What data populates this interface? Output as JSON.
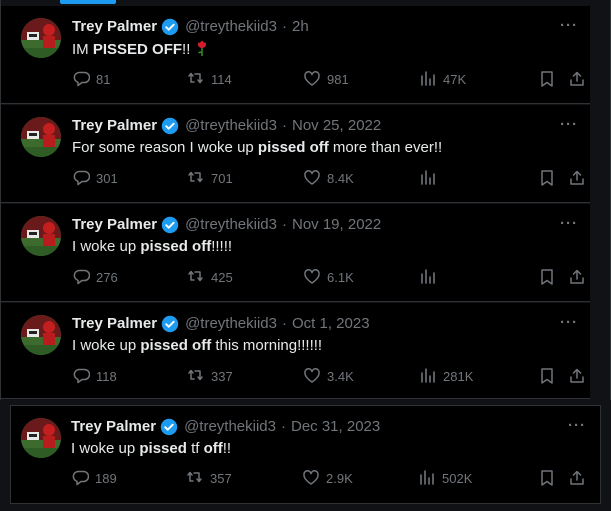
{
  "tweets": [
    {
      "name": "Trey Palmer",
      "handle": "@treythekiid3",
      "time": "2h",
      "text_parts": [
        [
          "IM ",
          false
        ],
        [
          "PISSED OFF",
          true
        ],
        [
          "!! ",
          false
        ]
      ],
      "emoji": "rose-emoji",
      "replies": "81",
      "retweets": "114",
      "likes": "981",
      "views": "47K"
    },
    {
      "name": "Trey Palmer",
      "handle": "@treythekiid3",
      "time": "Nov 25, 2022",
      "text_parts": [
        [
          "For some reason I woke up ",
          false
        ],
        [
          "pissed off",
          true
        ],
        [
          " more than ever!!",
          false
        ]
      ],
      "replies": "301",
      "retweets": "701",
      "likes": "8.4K",
      "views": ""
    },
    {
      "name": "Trey Palmer",
      "handle": "@treythekiid3",
      "time": "Nov 19, 2022",
      "text_parts": [
        [
          "I woke up ",
          false
        ],
        [
          "pissed off",
          true
        ],
        [
          "!!!!!",
          false
        ]
      ],
      "replies": "276",
      "retweets": "425",
      "likes": "6.1K",
      "views": ""
    },
    {
      "name": "Trey Palmer",
      "handle": "@treythekiid3",
      "time": "Oct 1, 2023",
      "text_parts": [
        [
          "I woke up ",
          false
        ],
        [
          "pissed off",
          true
        ],
        [
          " this morning!!!!!!",
          false
        ]
      ],
      "replies": "118",
      "retweets": "337",
      "likes": "3.4K",
      "views": "281K"
    },
    {
      "name": "Trey Palmer",
      "handle": "@treythekiid3",
      "time": "Dec 31, 2023",
      "text_parts": [
        [
          "I woke up ",
          false
        ],
        [
          "pissed",
          true
        ],
        [
          " tf ",
          false
        ],
        [
          "off",
          true
        ],
        [
          "!!",
          false
        ]
      ],
      "replies": "189",
      "retweets": "357",
      "likes": "2.9K",
      "views": "502K"
    }
  ],
  "more_glyph": "···",
  "dot_glyph": "·",
  "colors": {
    "accent": "#1d9bf0",
    "muted": "#71767b",
    "text": "#e7e9ea",
    "background": "#000000"
  }
}
